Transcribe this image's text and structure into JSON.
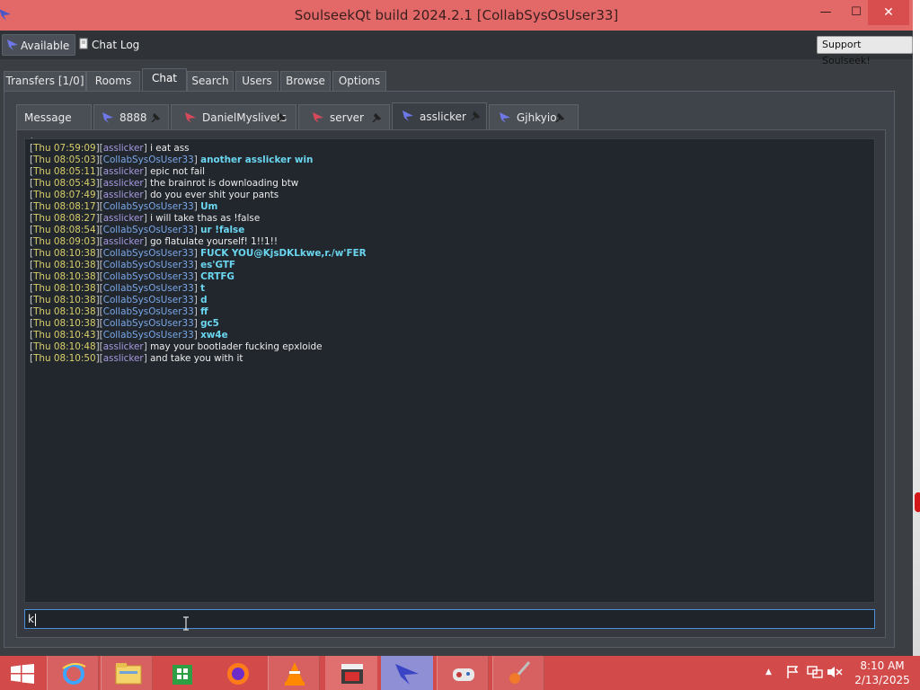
{
  "window": {
    "title": "SoulseekQt build 2024.2.1 [CollabSysOsUser33]",
    "min": "—",
    "max": "☐",
    "close": "✕"
  },
  "toolbar": {
    "status": "Available",
    "chat_log": "Chat Log",
    "support": "Support Soulseek!"
  },
  "main_tabs": [
    "Transfers [1/0]",
    "Rooms",
    "Chat",
    "Search",
    "Users",
    "Browse",
    "Options"
  ],
  "chat_tabs": [
    "Message List",
    "8888",
    "DanielMyslivets",
    "server",
    "asslicker",
    "Gjhkyio"
  ],
  "messages": [
    {
      "ts": "Thu 07:59:09",
      "user": "asslicker",
      "text": "i eat ass",
      "self": false
    },
    {
      "ts": "Thu 08:05:03",
      "user": "CollabSysOsUser33",
      "text": "another asslicker win",
      "self": true
    },
    {
      "ts": "Thu 08:05:11",
      "user": "asslicker",
      "text": "epic not fail",
      "self": false
    },
    {
      "ts": "Thu 08:05:43",
      "user": "asslicker",
      "text": "the brainrot is downloading btw",
      "self": false
    },
    {
      "ts": "Thu 08:07:49",
      "user": "asslicker",
      "text": "do you ever shit your pants",
      "self": false
    },
    {
      "ts": "Thu 08:08:17",
      "user": "CollabSysOsUser33",
      "text": "Um",
      "self": true
    },
    {
      "ts": "Thu 08:08:27",
      "user": "asslicker",
      "text": "i will take thas as !false",
      "self": false
    },
    {
      "ts": "Thu 08:08:54",
      "user": "CollabSysOsUser33",
      "text": "ur !false",
      "self": true
    },
    {
      "ts": "Thu 08:09:03",
      "user": "asslicker",
      "text": "go flatulate yourself! 1!!1!!",
      "self": false
    },
    {
      "ts": "Thu 08:10:38",
      "user": "CollabSysOsUser33",
      "text": "FUCK YOU@KjsDKLkwe,r./w'FER",
      "self": true
    },
    {
      "ts": "Thu 08:10:38",
      "user": "CollabSysOsUser33",
      "text": "es'GTF",
      "self": true
    },
    {
      "ts": "Thu 08:10:38",
      "user": "CollabSysOsUser33",
      "text": "CRTFG",
      "self": true
    },
    {
      "ts": "Thu 08:10:38",
      "user": "CollabSysOsUser33",
      "text": "t",
      "self": true
    },
    {
      "ts": "Thu 08:10:38",
      "user": "CollabSysOsUser33",
      "text": "d",
      "self": true
    },
    {
      "ts": "Thu 08:10:38",
      "user": "CollabSysOsUser33",
      "text": "ff",
      "self": true
    },
    {
      "ts": "Thu 08:10:38",
      "user": "CollabSysOsUser33",
      "text": "gc5",
      "self": true
    },
    {
      "ts": "Thu 08:10:43",
      "user": "CollabSysOsUser33",
      "text": "xw4e",
      "self": true
    },
    {
      "ts": "Thu 08:10:48",
      "user": "asslicker",
      "text": "may your bootlader fucking epxloide",
      "self": false
    },
    {
      "ts": "Thu 08:10:50",
      "user": "asslicker",
      "text": "and take you with it",
      "self": false
    }
  ],
  "input": {
    "value": "k"
  },
  "taskbar": {
    "time": "8:10 AM",
    "date": "2/13/2025"
  }
}
